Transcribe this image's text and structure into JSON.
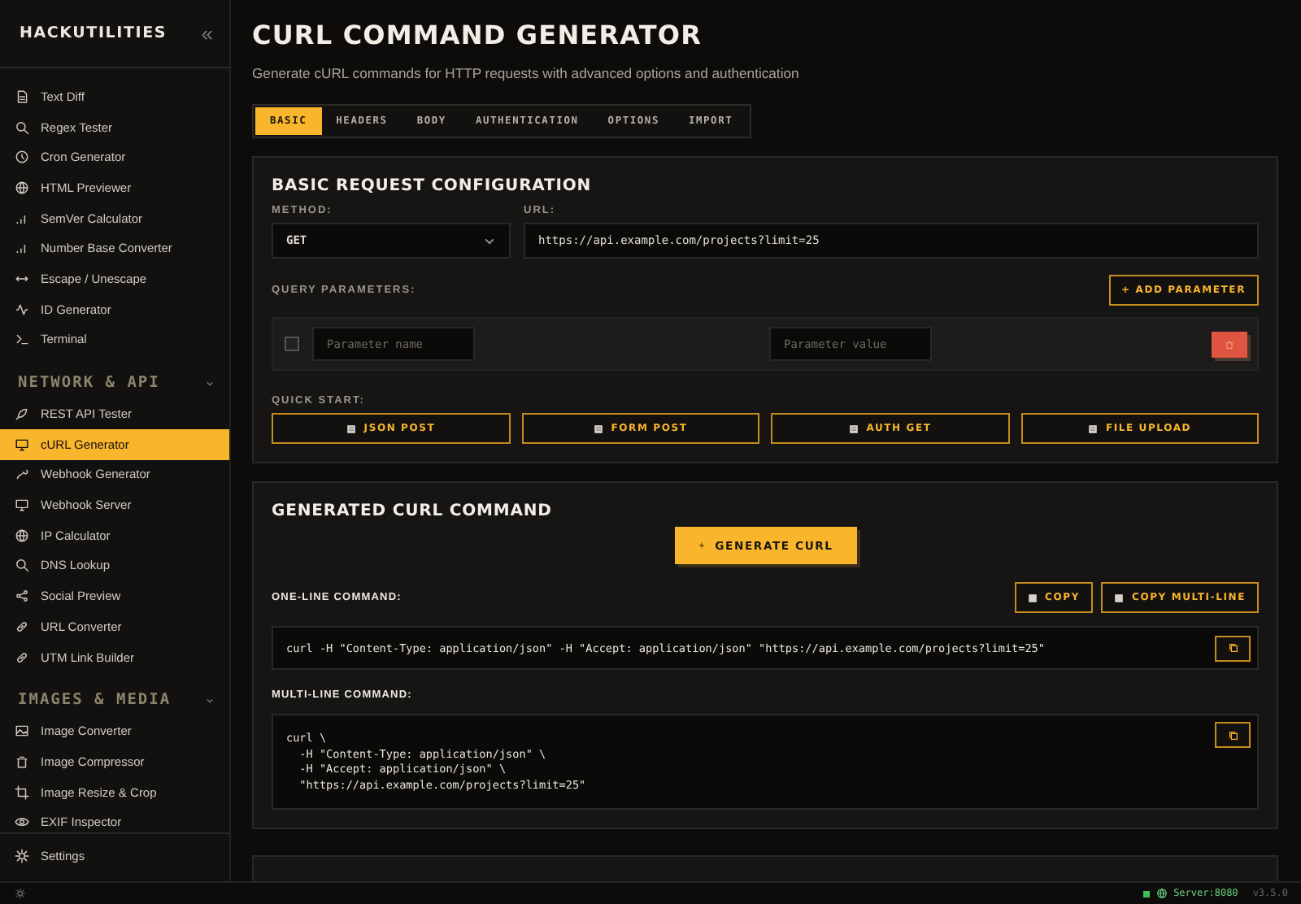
{
  "app": {
    "name": "HACKUTILITIES",
    "collapse": "«"
  },
  "sidebar": {
    "sections": [
      {
        "items": [
          {
            "label": "Text Diff",
            "selected": false
          },
          {
            "label": "Regex Tester",
            "selected": false
          },
          {
            "label": "Cron Generator",
            "selected": false
          },
          {
            "label": "HTML Previewer",
            "selected": false
          },
          {
            "label": "SemVer Calculator",
            "selected": false
          },
          {
            "label": "Number Base Converter",
            "selected": false
          },
          {
            "label": "Escape / Unescape",
            "selected": false
          },
          {
            "label": "ID Generator",
            "selected": false
          },
          {
            "label": "Terminal",
            "selected": false
          }
        ]
      },
      {
        "title": "NETWORK & API",
        "items": [
          {
            "label": "REST API Tester",
            "selected": false
          },
          {
            "label": "cURL Generator",
            "selected": true
          },
          {
            "label": "Webhook Generator",
            "selected": false
          },
          {
            "label": "Webhook Server",
            "selected": false
          },
          {
            "label": "IP Calculator",
            "selected": false
          },
          {
            "label": "DNS Lookup",
            "selected": false
          },
          {
            "label": "Social Preview",
            "selected": false
          },
          {
            "label": "URL Converter",
            "selected": false
          },
          {
            "label": "UTM Link Builder",
            "selected": false
          }
        ]
      },
      {
        "title": "IMAGES & MEDIA",
        "items": [
          {
            "label": "Image Converter",
            "selected": false
          },
          {
            "label": "Image Compressor",
            "selected": false
          },
          {
            "label": "Image Resize & Crop",
            "selected": false
          },
          {
            "label": "EXIF Inspector",
            "selected": false
          }
        ]
      }
    ],
    "footer": {
      "label": "Settings"
    }
  },
  "page": {
    "title": "CURL COMMAND GENERATOR",
    "subtitle": "Generate cURL commands for HTTP requests with advanced options and authentication"
  },
  "tabs": [
    {
      "label": "BASIC",
      "selected": true
    },
    {
      "label": "HEADERS",
      "selected": false
    },
    {
      "label": "BODY",
      "selected": false
    },
    {
      "label": "AUTHENTICATION",
      "selected": false
    },
    {
      "label": "OPTIONS",
      "selected": false
    },
    {
      "label": "IMPORT",
      "selected": false
    }
  ],
  "basic_card": {
    "title": "BASIC REQUEST CONFIGURATION",
    "method_label": "METHOD:",
    "method": "GET",
    "url_label": "URL:",
    "url": "https://api.example.com/projects?limit=25",
    "query_label": "QUERY PARAMETERS:",
    "add_button": "+ ADD PARAMETER",
    "params": [
      {
        "checked": false,
        "name_placeholder": "Parameter name",
        "value_placeholder": "Parameter value"
      }
    ],
    "quick_label": "QUICK START:",
    "quick_buttons": [
      "JSON POST",
      "FORM POST",
      "AUTH GET",
      "FILE UPLOAD"
    ]
  },
  "generated_card": {
    "title": "GENERATED CURL COMMAND",
    "generate_button": "GENERATE CURL",
    "one_line_label": "ONE-LINE COMMAND:",
    "copy_buttons": [
      "COPY",
      "COPY MULTI-LINE"
    ],
    "one_line": "curl -H \"Content-Type: application/json\" -H \"Accept: application/json\" \"https://api.example.com/projects?limit=25\"",
    "multi_line_label": "MULTI-LINE COMMAND:",
    "multi_line": [
      "curl \\",
      "  -H \"Content-Type: application/json\" \\",
      "  -H \"Accept: application/json\" \\",
      "  \"https://api.example.com/projects?limit=25\""
    ]
  },
  "status_bar": {
    "server": "Server:8080",
    "version": "v3.5.0"
  }
}
